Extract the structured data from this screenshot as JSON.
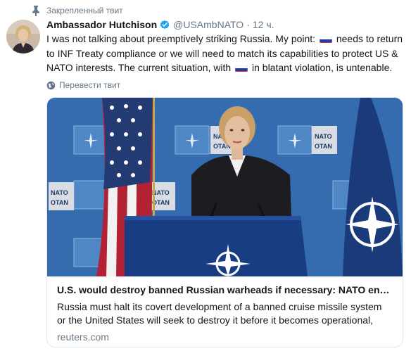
{
  "pinned": {
    "label": "Закрепленный твит",
    "icon": "pin-icon"
  },
  "author": {
    "name": "Ambassador Hutchison",
    "handle": "@USAmbNATO",
    "separator": "·",
    "time": "12 ч.",
    "verified_icon": "verified-badge-icon",
    "avatar_icon": "avatar-photo"
  },
  "tweet": {
    "part1": "I was not talking about preemptively striking Russia. My point: ",
    "part2": " needs to return to INF Treaty compliance or we will need to match its capabilities to protect US & NATO interests. The current situation, with ",
    "part3": " in blatant violation, is untenable.",
    "flag_emoji": "russian-flag-icon"
  },
  "translate": {
    "label": "Перевести твит",
    "icon": "globe-icon"
  },
  "card": {
    "image": "photo-of-speaker-at-nato-podium",
    "title": "U.S. would destroy banned Russian warheads if necessary: NATO envoy",
    "description": "Russia must halt its covert development of a banned cruise missile system or the United States will seek to destroy it before it becomes operational,",
    "domain": "reuters.com"
  },
  "colors": {
    "text": "#14171a",
    "secondary": "#657786",
    "verified": "#1da1f2",
    "border": "#e1e8ed",
    "nato_blue": "#004990"
  }
}
